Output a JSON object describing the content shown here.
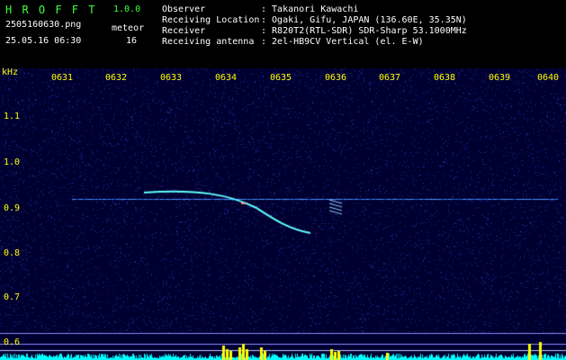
{
  "header": {
    "app_name": "H R O F F T",
    "version": "1.0.0",
    "filename": "2505160630.png",
    "datetime": "25.05.16 06:30",
    "counter_label": "meteor",
    "counter_value": "16"
  },
  "info": {
    "rows": [
      {
        "label": "Observer",
        "value": ": Takanori Kawachi"
      },
      {
        "label": "Receiving Location",
        "value": ": Ogaki, Gifu, JAPAN (136.60E, 35.35N)"
      },
      {
        "label": "Receiver",
        "value": ": R820T2(RTL-SDR) SDR-Sharp 53.1000MHz"
      },
      {
        "label": "Receiving antenna",
        "value": ": 2el-HB9CV Vertical (el. E-W)"
      }
    ]
  },
  "axes": {
    "y_unit": "kHz",
    "x_ticks": [
      "0631",
      "0632",
      "0633",
      "0634",
      "0635",
      "0636",
      "0637",
      "0638",
      "0639",
      "0640"
    ],
    "y_ticks": [
      "1.1",
      "1.0",
      "0.9",
      "0.8",
      "0.7",
      "0.6"
    ]
  },
  "colors": {
    "background": "#000000",
    "plot_background": "#000030",
    "title_green": "#40ff40",
    "label_yellow": "#ffff00",
    "meteor_cyan": "#60ffff",
    "spectrum_cyan": "#00ffff"
  }
}
